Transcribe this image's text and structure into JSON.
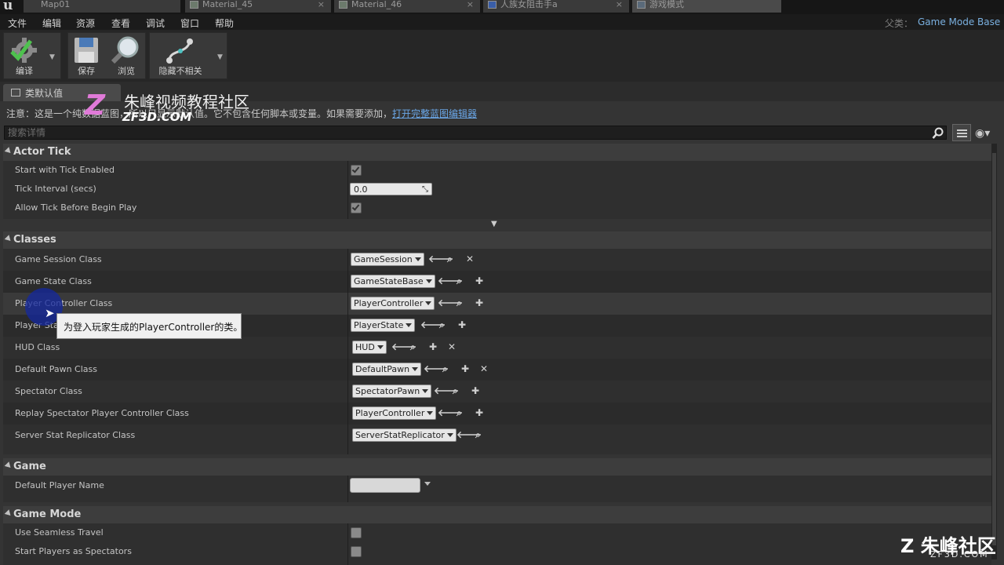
{
  "tabs": [
    {
      "label": "Map01"
    },
    {
      "label": "Material_45"
    },
    {
      "label": "Material_46"
    },
    {
      "label": "人族女阻击手a"
    },
    {
      "label": "游戏模式"
    }
  ],
  "menu": [
    "文件",
    "编辑",
    "资源",
    "查看",
    "调试",
    "窗口",
    "帮助"
  ],
  "parent": {
    "label": "父类：",
    "value": "Game Mode Base"
  },
  "toolbar": {
    "compile": "编译",
    "save": "保存",
    "browse": "浏览",
    "hide_unrelated": "隐藏不相关"
  },
  "panel": {
    "tab_label": "类默认值",
    "notice": "注意：这是一个纯数据蓝图，所以只显示默认值。它不包含任何脚本或变量。如果需要添加，",
    "notice_link": "打开完整蓝图编辑器",
    "search_placeholder": "搜索详情"
  },
  "sections": {
    "actor_tick": {
      "title": "Actor Tick",
      "rows": [
        {
          "name": "Start with Tick Enabled",
          "checked": true
        },
        {
          "name": "Tick Interval (secs)",
          "value": "0.0"
        },
        {
          "name": "Allow Tick Before Begin Play",
          "checked": true
        }
      ]
    },
    "classes": {
      "title": "Classes",
      "rows": [
        {
          "name": "Game Session Class",
          "value": "GameSession"
        },
        {
          "name": "Game State Class",
          "value": "GameStateBase"
        },
        {
          "name": "Player Controller Class",
          "value": "PlayerController"
        },
        {
          "name": "Player State Class",
          "value": "PlayerState"
        },
        {
          "name": "HUD Class",
          "value": "HUD"
        },
        {
          "name": "Default Pawn Class",
          "value": "DefaultPawn"
        },
        {
          "name": "Spectator Class",
          "value": "SpectatorPawn"
        },
        {
          "name": "Replay Spectator Player Controller Class",
          "value": "PlayerController"
        },
        {
          "name": "Server Stat Replicator Class",
          "value": "ServerStatReplicator"
        }
      ]
    },
    "game": {
      "title": "Game",
      "rows": [
        {
          "name": "Default Player Name",
          "value": ""
        }
      ]
    },
    "game_mode": {
      "title": "Game Mode",
      "rows": [
        {
          "name": "Use Seamless Travel",
          "checked": false
        },
        {
          "name": "Start Players as Spectators",
          "checked": false
        }
      ]
    }
  },
  "tooltip": "为登入玩家生成的PlayerController的类。",
  "watermark": {
    "title": "朱峰视频教程社区",
    "sub": "ZF3D.COM",
    "z": "Z",
    "corner": "Z 朱峰社区",
    "corner_sub": "ZF3D.COM"
  },
  "colors": {
    "link": "#6aa6e6",
    "parent_value": "#7ab0e0",
    "highlight": "#1428a0"
  },
  "icons": [
    "gear-check-icon",
    "floppy-disk-icon",
    "magnifier-icon",
    "hide-unrelated-icon",
    "arrow-left-icon",
    "search-icon",
    "plus-icon",
    "clear-x-icon",
    "eye-icon",
    "list-view-icon"
  ]
}
